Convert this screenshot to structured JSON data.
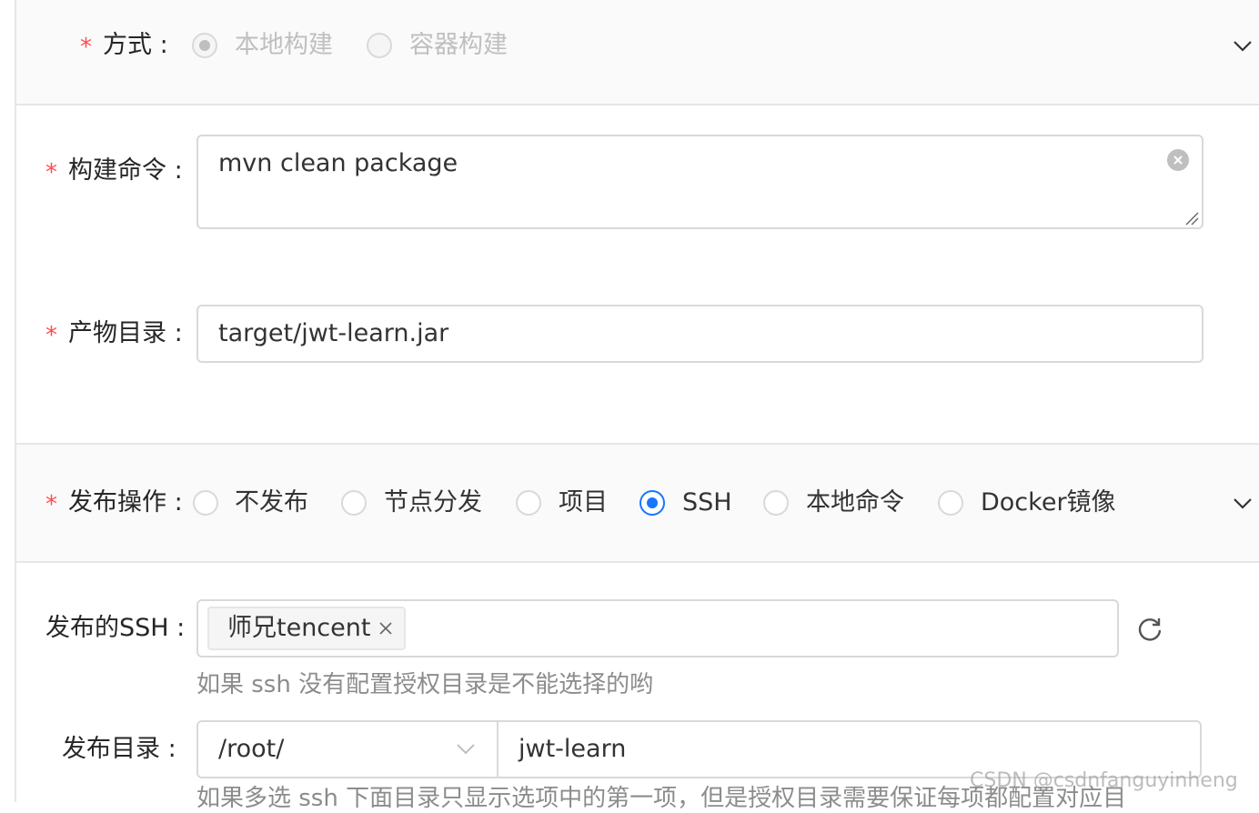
{
  "build": {
    "method_label": "方式 :",
    "method_options": [
      {
        "label": "本地构建",
        "checked": true,
        "disabled": true
      },
      {
        "label": "容器构建",
        "checked": false,
        "disabled": true
      }
    ],
    "command_label": "构建命令 :",
    "command_value": "mvn clean package",
    "artifact_label": "产物目录 :",
    "artifact_value": "target/jwt-learn.jar"
  },
  "release": {
    "operation_label": "发布操作 :",
    "operation_options": [
      {
        "label": "不发布",
        "checked": false
      },
      {
        "label": "节点分发",
        "checked": false
      },
      {
        "label": "项目",
        "checked": false
      },
      {
        "label": "SSH",
        "checked": true
      },
      {
        "label": "本地命令",
        "checked": false
      },
      {
        "label": "Docker镜像",
        "checked": false
      }
    ],
    "ssh_label": "发布的SSH :",
    "ssh_tag": "师兄tencent",
    "ssh_hint": "如果 ssh 没有配置授权目录是不能选择的哟",
    "dir_label": "发布目录 :",
    "dir_select_value": "/root/",
    "dir_input_value": "jwt-learn",
    "dir_hint": "如果多选 ssh 下面目录只显示选项中的第一项，但是授权目录需要保证每项都配置对应目"
  },
  "watermark": "CSDN @csdnfanguyinheng",
  "colors": {
    "required": "#ff4d4f",
    "primary": "#1677ff",
    "border": "#d9d9d9"
  }
}
